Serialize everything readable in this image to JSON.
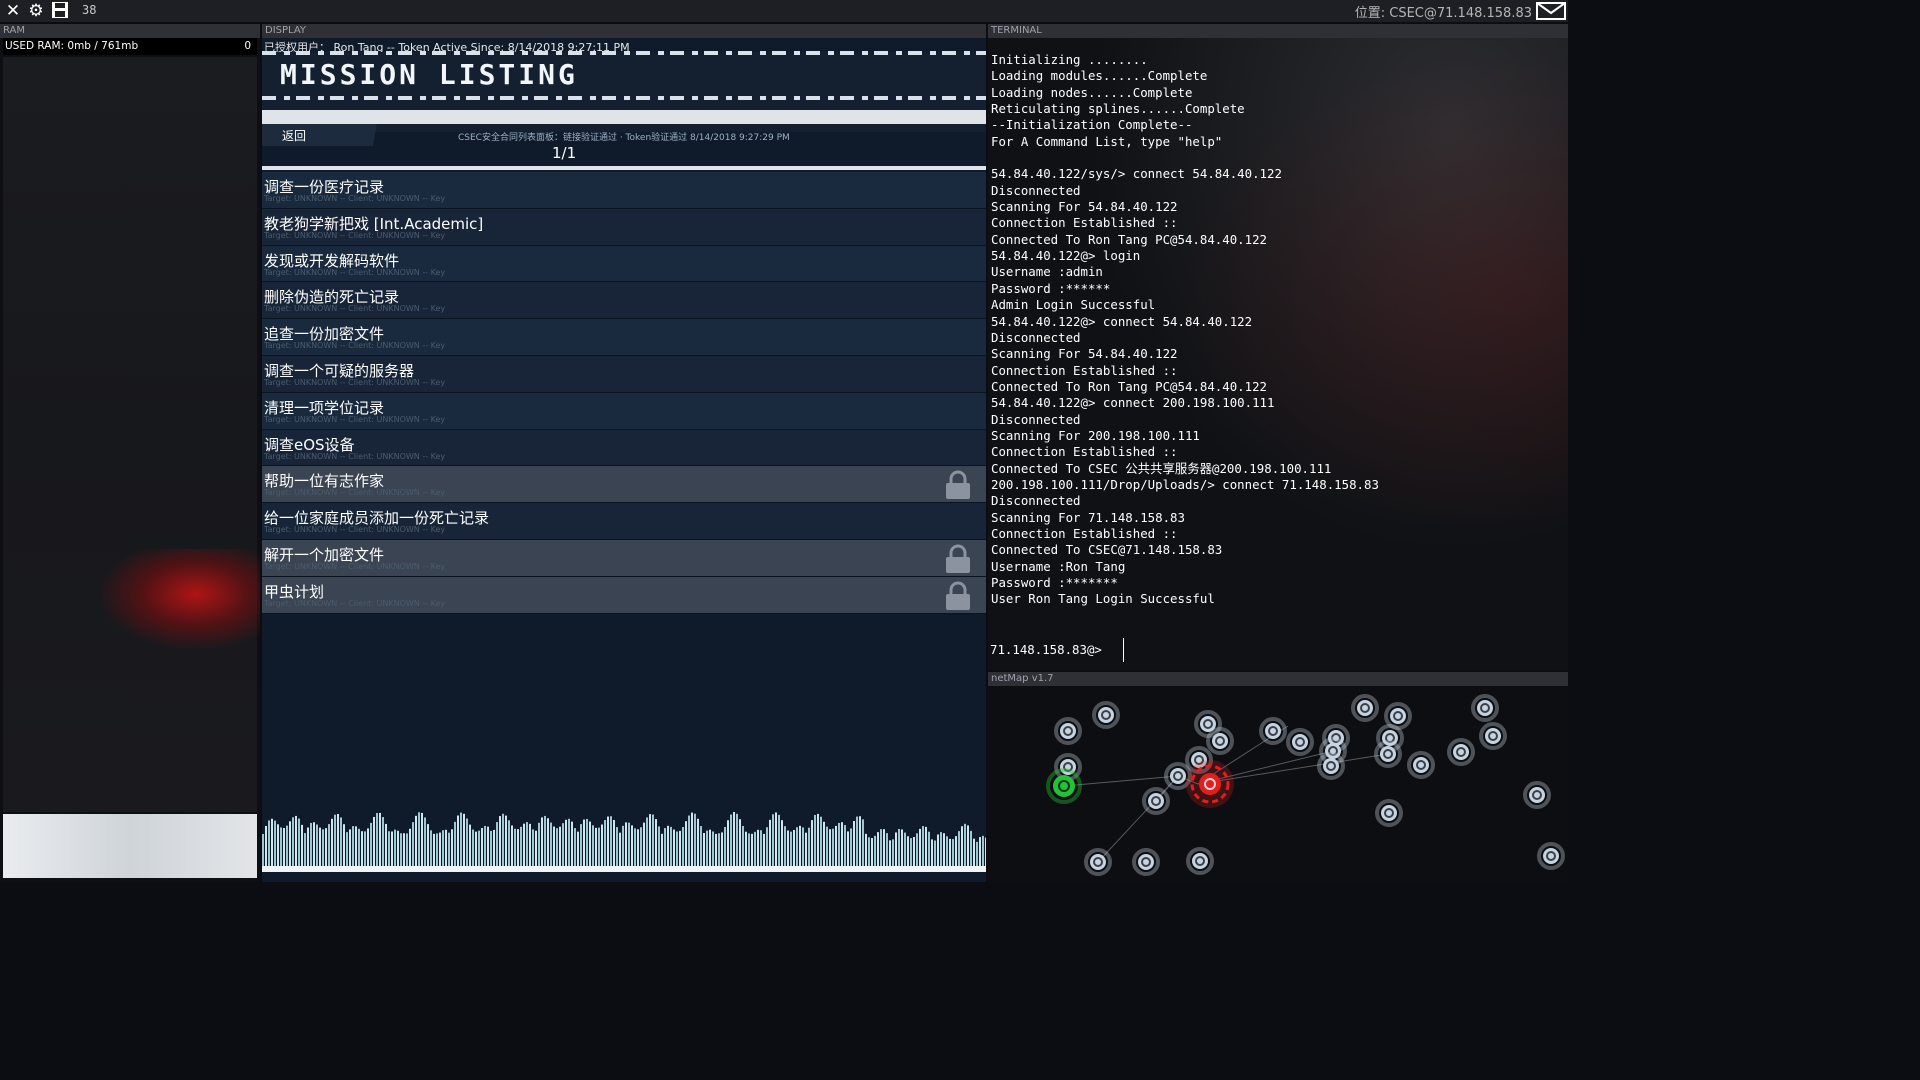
{
  "topbar": {
    "count": "38",
    "location": "位置: CSEC@71.148.158.83"
  },
  "ram": {
    "header": "RAM",
    "used": "USED RAM: 0mb / 761mb",
    "count": "0"
  },
  "display": {
    "header": "DISPLAY",
    "user_line": "已授权用户：  Ron Tang  --  Token Active Since: 8/14/2018 9:27:11 PM",
    "title": "MISSION LISTING",
    "back_label": "返回",
    "cert_line": "CSEC安全合同列表面板：链接验证通过  ·  Token验证通过 8/14/2018 9:27:29 PM",
    "page": "1/1",
    "missions": [
      {
        "title": "调查一份医疗记录",
        "sub": "Target: UNKNOWN -- Client: UNKNOWN -- Key",
        "locked": false
      },
      {
        "title": "教老狗学新把戏 [Int.Academic]",
        "sub": "Target: UNKNOWN -- Client: UNKNOWN -- Key",
        "locked": false
      },
      {
        "title": "发现或开发解码软件",
        "sub": "Target: UNKNOWN -- Client: UNKNOWN -- Key",
        "locked": false
      },
      {
        "title": "删除伪造的死亡记录",
        "sub": "Target: UNKNOWN -- Client: UNKNOWN -- Key",
        "locked": false
      },
      {
        "title": "追查一份加密文件",
        "sub": "Target: UNKNOWN -- Client: UNKNOWN -- Key",
        "locked": false
      },
      {
        "title": "调查一个可疑的服务器",
        "sub": "Target: UNKNOWN -- Client: UNKNOWN -- Key",
        "locked": false
      },
      {
        "title": "清理一项学位记录",
        "sub": "Target: UNKNOWN -- Client: UNKNOWN -- Key",
        "locked": false
      },
      {
        "title": "调查eOS设备",
        "sub": "Target: UNKNOWN -- Client: UNKNOWN -- Key",
        "locked": false
      },
      {
        "title": "帮助一位有志作家",
        "sub": "Target: UNKNOWN -- Client: UNKNOWN -- Key",
        "locked": true
      },
      {
        "title": "给一位家庭成员添加一份死亡记录",
        "sub": "Target: UNKNOWN -- Client: UNKNOWN -- Key",
        "locked": false
      },
      {
        "title": "解开一个加密文件",
        "sub": "Target: UNKNOWN -- Client: UNKNOWN -- Key",
        "locked": true
      },
      {
        "title": "甲虫计划",
        "sub": "Target: UNKNOWN -- Client: UNKNOWN -- Key",
        "locked": true
      }
    ]
  },
  "terminal": {
    "header": "TERMINAL",
    "lines": [
      "Initializing ........",
      "Loading modules......Complete",
      "Loading nodes......Complete",
      "Reticulating splines......Complete",
      "--Initialization Complete--",
      "For A Command List, type \"help\"",
      "",
      "54.84.40.122/sys/> connect 54.84.40.122",
      "Disconnected",
      "Scanning For 54.84.40.122",
      "Connection Established ::",
      "Connected To Ron Tang PC@54.84.40.122",
      "54.84.40.122@> login",
      "Username :admin",
      "Password :******",
      "Admin Login Successful",
      "54.84.40.122@> connect 54.84.40.122",
      "Disconnected",
      "Scanning For 54.84.40.122",
      "Connection Established ::",
      "Connected To Ron Tang PC@54.84.40.122",
      "54.84.40.122@> connect 200.198.100.111",
      "Disconnected",
      "Scanning For 200.198.100.111",
      "Connection Established ::",
      "Connected To CSEC 公共共享服务器@200.198.100.111",
      "200.198.100.111/Drop/Uploads/> connect 71.148.158.83",
      "Disconnected",
      "Scanning For 71.148.158.83",
      "Connection Established ::",
      "Connected To CSEC@71.148.158.83",
      "Username :Ron Tang",
      "Password :*******",
      "User Ron Tang Login Successful"
    ],
    "prompt": "71.148.158.83@>"
  },
  "netmap": {
    "header": "netMap v1.7",
    "colors": {
      "node": "#c6d3e0",
      "current": "#22c23a",
      "active": "#e02020"
    }
  }
}
